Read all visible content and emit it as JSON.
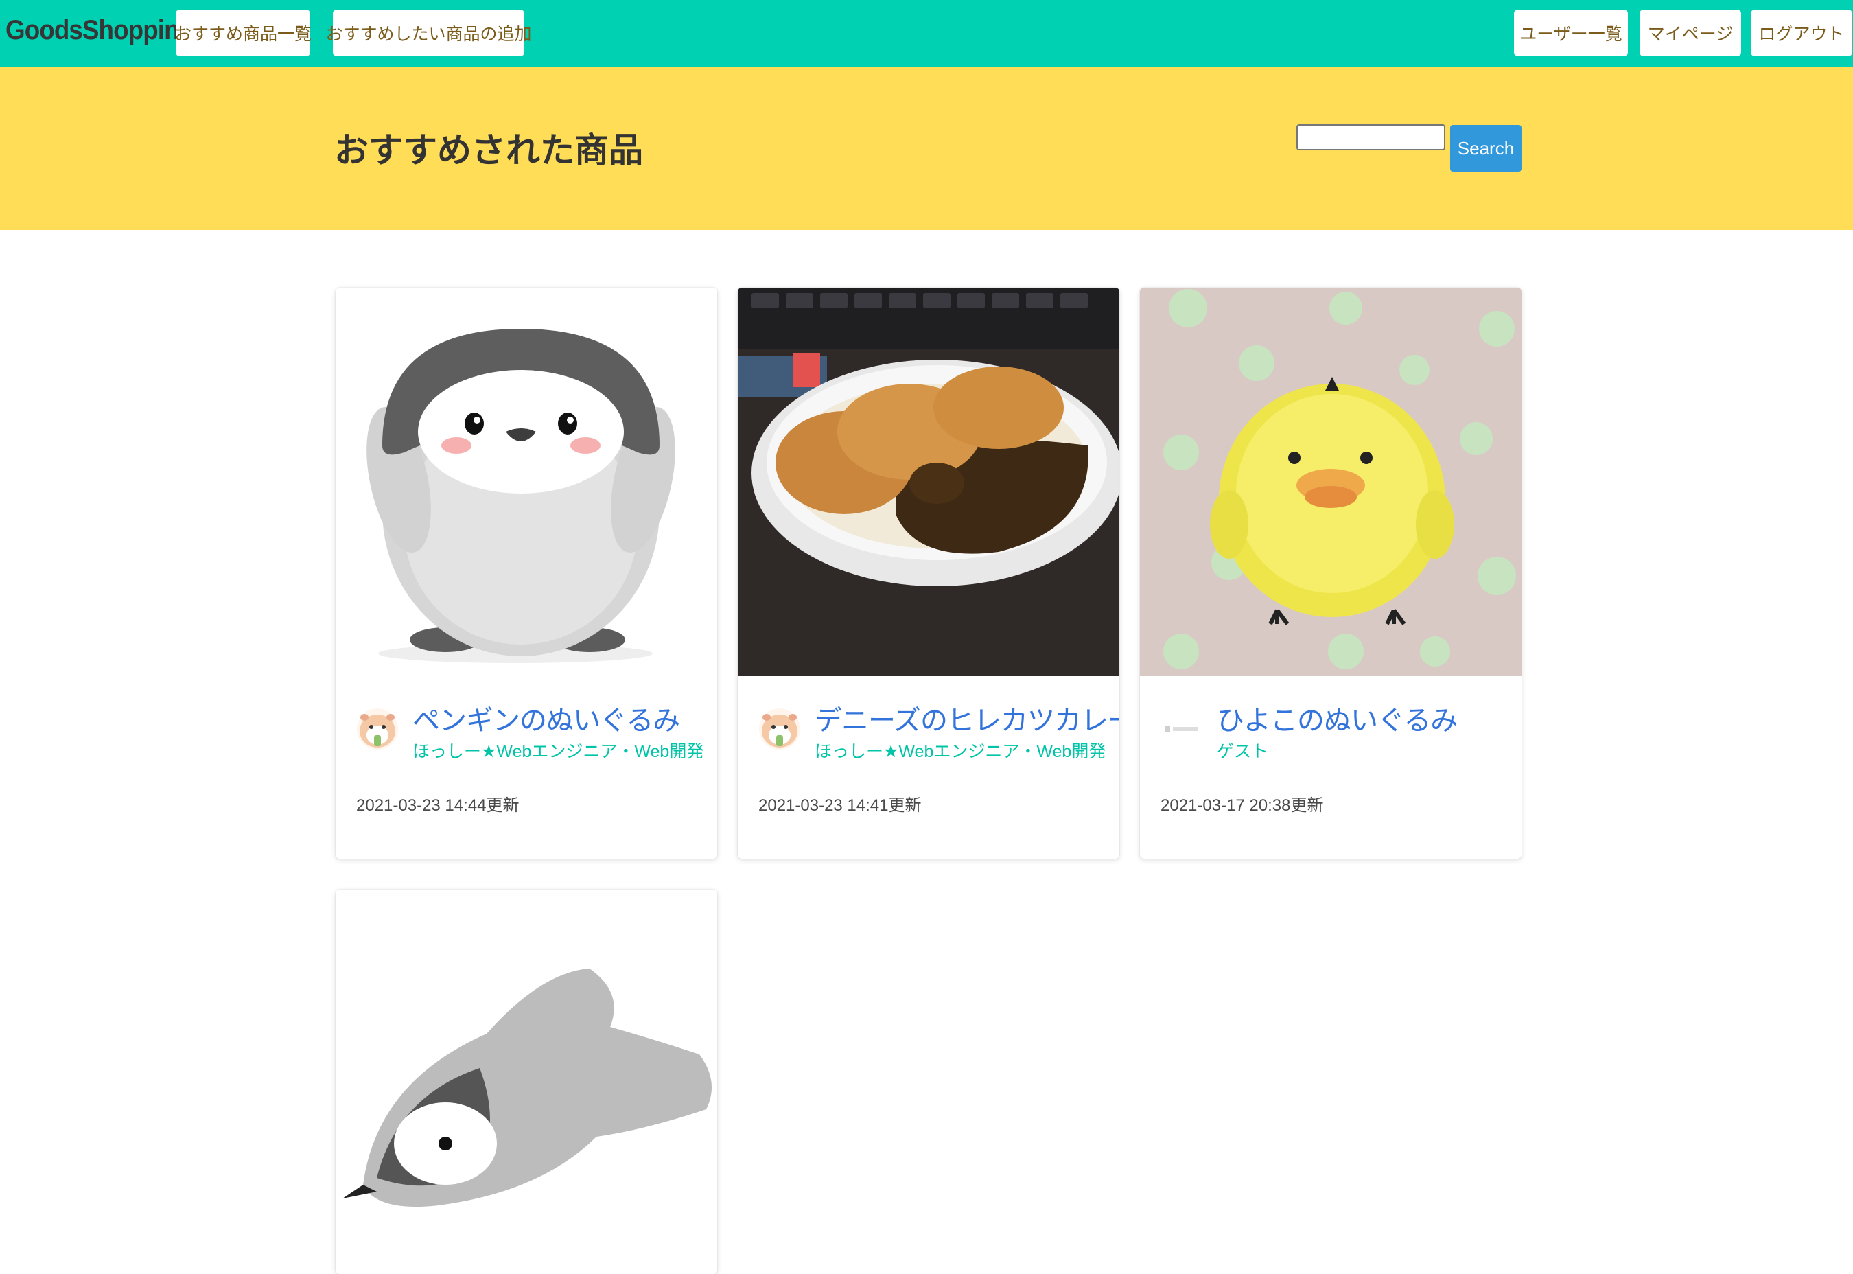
{
  "navbar": {
    "brand": "GoodsShopping",
    "left_links": [
      "おすすめ商品一覧",
      "おすすめしたい商品の追加"
    ],
    "right_links": [
      "ユーザー一覧",
      "マイページ",
      "ログアウト"
    ]
  },
  "hero": {
    "title": "おすすめされた商品",
    "search_value": "",
    "search_button": "Search"
  },
  "cards": [
    {
      "title": "ペンギンのぬいぐるみ",
      "user": "ほっしー★Webエンジニア・Web開発",
      "updated": "2021-03-23 14:44更新",
      "image": "penguin-plush"
    },
    {
      "title": "デニーズのヒレカツカレー",
      "user": "ほっしー★Webエンジニア・Web開発",
      "updated": "2021-03-23 14:41更新",
      "image": "katsu-curry"
    },
    {
      "title": "ひよこのぬいぐるみ",
      "user": "ゲスト",
      "updated": "2021-03-17 20:38更新",
      "image": "chick-plush"
    },
    {
      "title": "",
      "user": "",
      "updated": "",
      "image": "lying-penguin-plush"
    }
  ],
  "colors": {
    "navbar": "#00d1b2",
    "hero": "#ffdd57",
    "link": "#3273dc",
    "user": "#00c4a7",
    "search_button": "#3298dc"
  }
}
